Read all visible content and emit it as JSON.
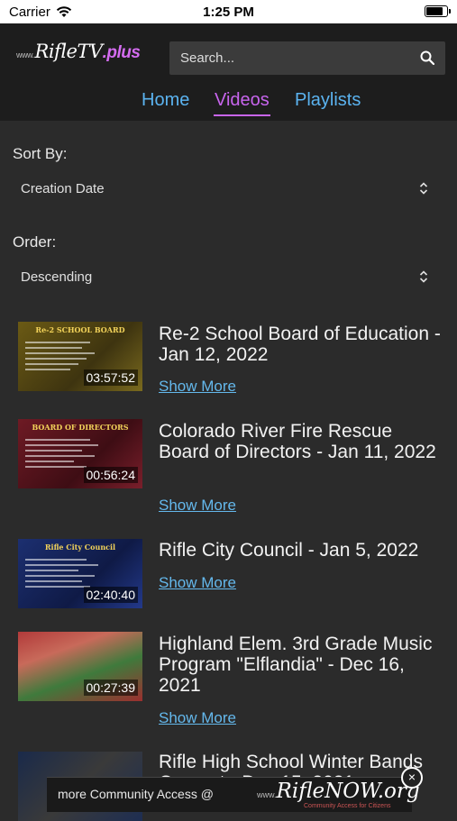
{
  "status_bar": {
    "carrier": "Carrier",
    "time": "1:25 PM"
  },
  "header": {
    "logo": {
      "prefix": "www.",
      "name": "RifleTV",
      "suffix": ".plus"
    },
    "search": {
      "placeholder": "Search..."
    },
    "nav": [
      {
        "label": "Home",
        "active": false
      },
      {
        "label": "Videos",
        "active": true
      },
      {
        "label": "Playlists",
        "active": false
      }
    ]
  },
  "sort": {
    "label": "Sort By:",
    "value": "Creation Date"
  },
  "order": {
    "label": "Order:",
    "value": "Descending"
  },
  "videos": [
    {
      "title": "Re-2 School Board of Education - Jan 12, 2022",
      "duration": "03:57:52",
      "thumb_text": "Re-2 SCHOOL BOARD",
      "show_more": "Show More"
    },
    {
      "title": "Colorado River Fire Rescue Board of Directors - Jan 11, 2022",
      "duration": "00:56:24",
      "thumb_text": "BOARD OF DIRECTORS",
      "show_more": "Show More"
    },
    {
      "title": "Rifle City Council - Jan 5, 2022",
      "duration": "02:40:40",
      "thumb_text": "Rifle City Council",
      "show_more": "Show More"
    },
    {
      "title": "Highland Elem. 3rd Grade Music Program \"Elflandia\" - Dec 16, 2021",
      "duration": "00:27:39",
      "thumb_text": "",
      "show_more": "Show More"
    },
    {
      "title": "Rifle High School Winter Bands Concert - Dec 15, 2021",
      "duration": "",
      "thumb_text": "",
      "show_more": ""
    }
  ],
  "ad_banner": {
    "text": "more Community Access @",
    "brand_prefix": "www.",
    "brand": "RifleNOW.org",
    "tagline": "Community Access for Citizens",
    "close": "×"
  },
  "colors": {
    "accent_blue": "#5bb3f0",
    "accent_purple": "#c865ee",
    "background": "#2b2b2b",
    "header": "#1d1d1d"
  }
}
